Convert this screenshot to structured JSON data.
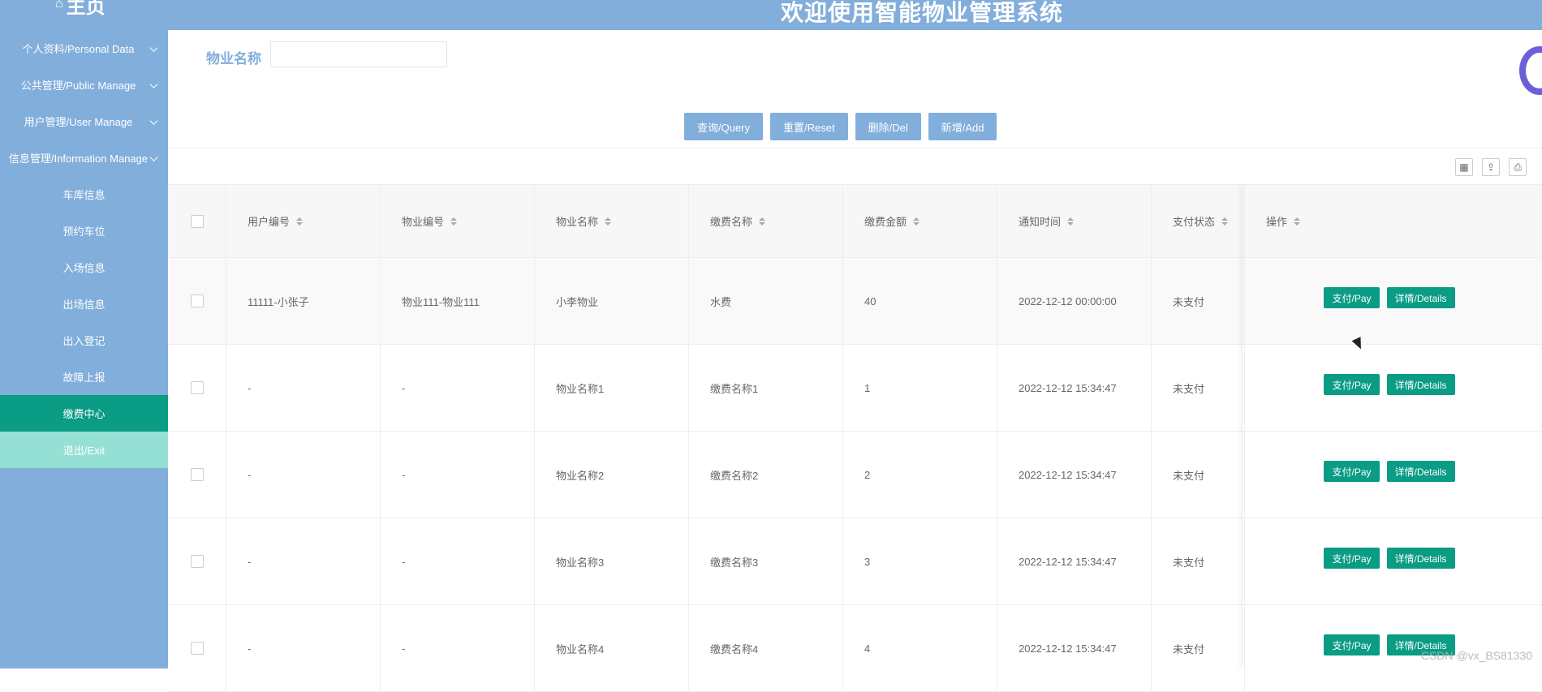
{
  "header": {
    "home_icon": "home-icon",
    "home_label": "主页",
    "title": "欢迎使用智能物业管理系统"
  },
  "sidebar": {
    "items": [
      {
        "label": "个人资料/Personal Data",
        "expandable": true
      },
      {
        "label": "公共管理/Public Manage",
        "expandable": true
      },
      {
        "label": "用户管理/User Manage",
        "expandable": true
      },
      {
        "label": "信息管理/Information Manage",
        "expandable": true
      },
      {
        "label": "车库信息"
      },
      {
        "label": "预约车位"
      },
      {
        "label": "入场信息"
      },
      {
        "label": "出场信息"
      },
      {
        "label": "出入登记"
      },
      {
        "label": "故障上报"
      },
      {
        "label": "缴费中心",
        "active": true
      },
      {
        "label": "退出/Exit"
      }
    ]
  },
  "search": {
    "label": "物业名称",
    "value": "",
    "placeholder": ""
  },
  "buttons": {
    "query": "查询/Query",
    "reset": "重置/Reset",
    "delete": "删除/Del",
    "add": "新增/Add"
  },
  "toolbar": {
    "icons": [
      "columns-icon",
      "export-icon",
      "print-icon"
    ]
  },
  "table": {
    "headers": [
      "用户编号",
      "物业编号",
      "物业名称",
      "缴费名称",
      "缴费金额",
      "通知时间",
      "支付状态",
      "操作"
    ],
    "rows": [
      {
        "user": "11111-小张子",
        "prop_no": "物业111-物业111",
        "prop_name": "小李物业",
        "fee_name": "水费",
        "amount": "40",
        "time": "2022-12-12 00:00:00",
        "status": "未支付"
      },
      {
        "user": "-",
        "prop_no": "-",
        "prop_name": "物业名称1",
        "fee_name": "缴费名称1",
        "amount": "1",
        "time": "2022-12-12 15:34:47",
        "status": "未支付"
      },
      {
        "user": "-",
        "prop_no": "-",
        "prop_name": "物业名称2",
        "fee_name": "缴费名称2",
        "amount": "2",
        "time": "2022-12-12 15:34:47",
        "status": "未支付"
      },
      {
        "user": "-",
        "prop_no": "-",
        "prop_name": "物业名称3",
        "fee_name": "缴费名称3",
        "amount": "3",
        "time": "2022-12-12 15:34:47",
        "status": "未支付"
      },
      {
        "user": "-",
        "prop_no": "-",
        "prop_name": "物业名称4",
        "fee_name": "缴费名称4",
        "amount": "4",
        "time": "2022-12-12 15:34:47",
        "status": "未支付"
      }
    ],
    "pay_label": "支付/Pay",
    "details_label": "详情/Details"
  },
  "watermark": "CSDN @vx_BS81330",
  "colors": {
    "primary": "#82aedb",
    "accent": "#0a9c84",
    "exit": "#95e0d4"
  }
}
